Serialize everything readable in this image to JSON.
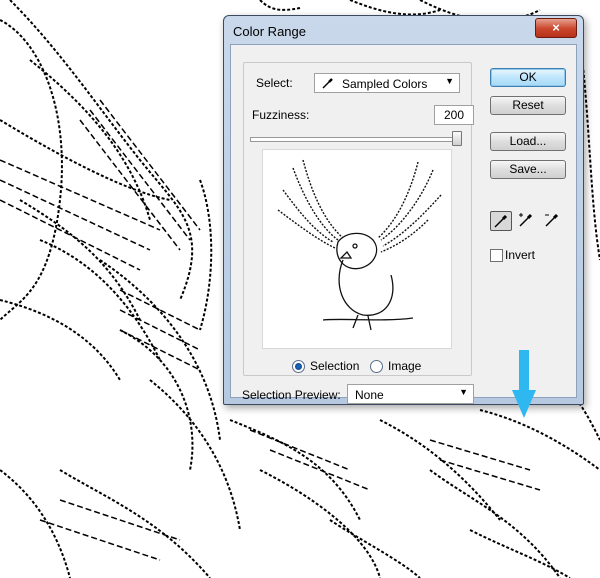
{
  "dialog": {
    "title": "Color Range",
    "close_glyph": "×",
    "select_label": "Select:",
    "select_value": "Sampled Colors",
    "fuzziness_label": "Fuzziness:",
    "fuzziness_value": "200",
    "fuzziness_level": 1.0,
    "radio_selection": "Selection",
    "radio_image": "Image",
    "radio_checked": "Selection",
    "selection_preview_label": "Selection Preview:",
    "selection_preview_value": "None",
    "buttons": {
      "ok": "OK",
      "reset": "Reset",
      "load": "Load...",
      "save": "Save..."
    },
    "invert_label": "Invert",
    "invert_checked": false,
    "tools": [
      "eyedropper-icon",
      "eyedropper-plus-icon",
      "eyedropper-minus-icon"
    ]
  },
  "colors": {
    "arrow": "#2fb8ef",
    "close": "#c8452a"
  }
}
